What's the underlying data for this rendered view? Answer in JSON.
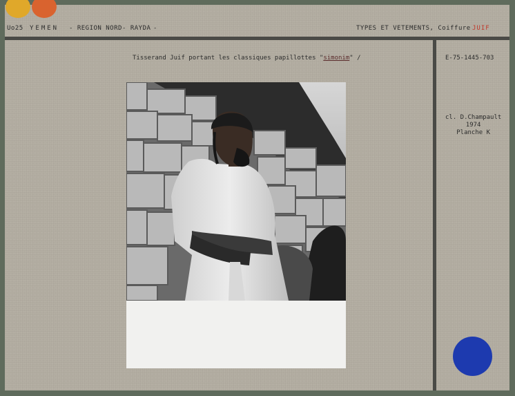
{
  "header": {
    "code": "Uo25",
    "country": "YEMEN",
    "region": "- REGION NORD",
    "place": "- RAYDA",
    "dash_end": "-",
    "category": "TYPES ET VETEMENTS, Coiffure",
    "group": "JUIF"
  },
  "caption": {
    "prefix": "Tisserand Juif portant les classiques papillottes \"",
    "underlined": "simonim",
    "suffix": "\" /"
  },
  "reference": "E-75-1445-703",
  "credit": {
    "line1": "cl. D.Champault",
    "line2": "1974",
    "line3": "Planche K"
  },
  "colors": {
    "card": "#b3aea2",
    "background": "#5f6b5c",
    "sticker_yellow": "#e0a82a",
    "sticker_orange": "#d9632f",
    "sticker_blue": "#1d3aaf",
    "accent_red": "#c0392b"
  }
}
